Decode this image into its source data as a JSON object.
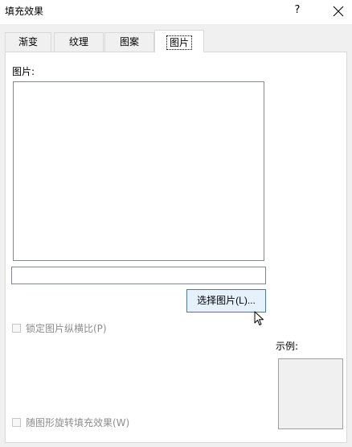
{
  "window": {
    "title": "填充效果",
    "help_label": "?"
  },
  "tabs": [
    {
      "label": "渐变",
      "active": false
    },
    {
      "label": "纹理",
      "active": false
    },
    {
      "label": "图案",
      "active": false
    },
    {
      "label": "图片",
      "active": true
    }
  ],
  "picture_section": {
    "label": "图片:",
    "filename_value": ""
  },
  "select_button": {
    "label": "选择图片(L)..."
  },
  "lock_aspect": {
    "label": "锁定图片纵横比(P)",
    "checked": false,
    "enabled": false
  },
  "rotate_with_shape": {
    "label": "随图形旋转填充效果(W)",
    "checked": false,
    "enabled": false
  },
  "sample": {
    "label": "示例:"
  },
  "icons": {
    "close": "close-icon",
    "cursor": "mouse-cursor-icon"
  }
}
